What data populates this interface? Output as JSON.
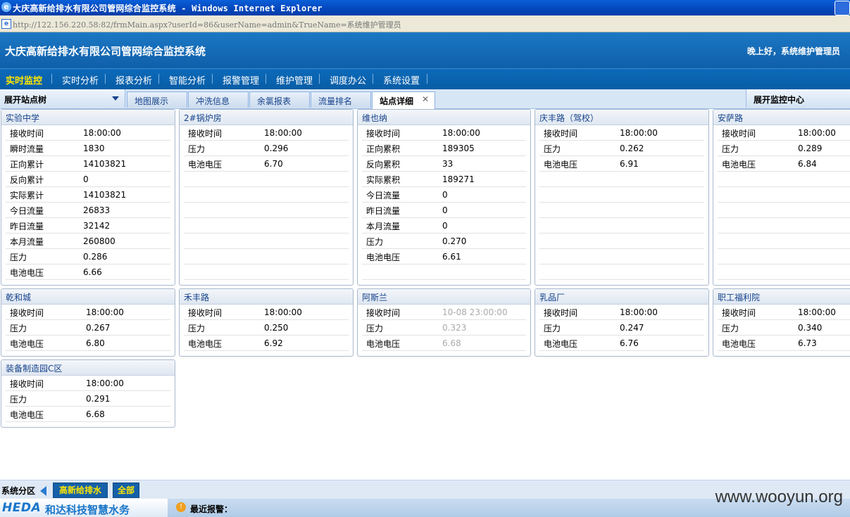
{
  "window": {
    "title": "大庆高新给排水有限公司管网综合监控系统 - Windows Internet Explorer",
    "url": "http://122.156.220.58:82/frmMain.aspx?userId=86&userName=admin&TrueName=系统维护管理员"
  },
  "header": {
    "title": "大庆高新给排水有限公司管网综合监控系统",
    "greeting": "晚上好，系统维护管理员"
  },
  "nav": [
    "实时监控",
    "实时分析",
    "报表分析",
    "智能分析",
    "报警管理",
    "维护管理",
    "调度办公",
    "系统设置"
  ],
  "tree_header": "展开站点树",
  "tabs": [
    "地图展示",
    "冲洗信息",
    "余氯报表",
    "流量排名",
    "站点详细"
  ],
  "monitor_header": "展开监控中心",
  "stations": [
    {
      "name": "实验中学",
      "rows": [
        [
          "接收时间",
          "18:00:00"
        ],
        [
          "瞬时流量",
          "1830"
        ],
        [
          "正向累计",
          "14103821"
        ],
        [
          "反向累计",
          "0"
        ],
        [
          "实际累计",
          "14103821"
        ],
        [
          "今日流量",
          "26833"
        ],
        [
          "昨日流量",
          "32142"
        ],
        [
          "本月流量",
          "260800"
        ],
        [
          "压力",
          "0.286"
        ],
        [
          "电池电压",
          "6.66"
        ]
      ]
    },
    {
      "name": "2#锅炉房",
      "rows": [
        [
          "接收时间",
          "18:00:00"
        ],
        [
          "压力",
          "0.296"
        ],
        [
          "电池电压",
          "6.70"
        ]
      ]
    },
    {
      "name": "维也纳",
      "rows": [
        [
          "接收时间",
          "18:00:00"
        ],
        [
          "正向累积",
          "189305"
        ],
        [
          "反向累积",
          "33"
        ],
        [
          "实际累积",
          "189271"
        ],
        [
          "今日流量",
          "0"
        ],
        [
          "昨日流量",
          "0"
        ],
        [
          "本月流量",
          "0"
        ],
        [
          "压力",
          "0.270"
        ],
        [
          "电池电压",
          "6.61"
        ]
      ]
    },
    {
      "name": "庆丰路（驾校）",
      "rows": [
        [
          "接收时间",
          "18:00:00"
        ],
        [
          "压力",
          "0.262"
        ],
        [
          "电池电压",
          "6.91"
        ]
      ]
    },
    {
      "name": "安萨路",
      "rows": [
        [
          "接收时间",
          "18:00:00"
        ],
        [
          "压力",
          "0.289"
        ],
        [
          "电池电压",
          "6.84"
        ]
      ]
    },
    {
      "name": "乾和城",
      "rows": [
        [
          "接收时间",
          "18:00:00"
        ],
        [
          "压力",
          "0.267"
        ],
        [
          "电池电压",
          "6.80"
        ]
      ]
    },
    {
      "name": "禾丰路",
      "rows": [
        [
          "接收时间",
          "18:00:00"
        ],
        [
          "压力",
          "0.250"
        ],
        [
          "电池电压",
          "6.92"
        ]
      ]
    },
    {
      "name": "阿斯兰",
      "rows": [
        [
          "接收时间",
          "10-08 23:00:00"
        ],
        [
          "压力",
          "0.323"
        ],
        [
          "电池电压",
          "6.68"
        ]
      ]
    },
    {
      "name": "乳品厂",
      "rows": [
        [
          "接收时间",
          "18:00:00"
        ],
        [
          "压力",
          "0.247"
        ],
        [
          "电池电压",
          "6.76"
        ]
      ]
    },
    {
      "name": "职工福利院",
      "rows": [
        [
          "接收时间",
          "18:00:00"
        ],
        [
          "压力",
          "0.340"
        ],
        [
          "电池电压",
          "6.73"
        ]
      ]
    },
    {
      "name": "装备制造园C区",
      "rows": [
        [
          "接收时间",
          "18:00:00"
        ],
        [
          "压力",
          "0.291"
        ],
        [
          "电池电压",
          "6.68"
        ]
      ]
    }
  ],
  "bottom": {
    "label": "系统分区",
    "buttons": [
      "高新给排水",
      "全部"
    ]
  },
  "footer": {
    "logo": "HEDA",
    "company": "和达科技智慧水务",
    "alarm_label": "最近报警：",
    "watermark": "www.wooyun.org"
  }
}
